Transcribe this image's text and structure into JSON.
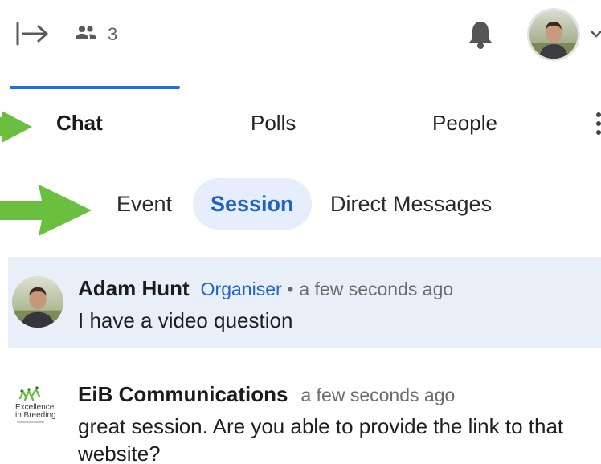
{
  "topbar": {
    "people_count": "3",
    "icons": [
      "exit-arrow-icon",
      "people-icon",
      "bell-icon",
      "user-avatar",
      "chevron-down-icon"
    ]
  },
  "tabs": {
    "items": [
      {
        "label": "Chat",
        "active": true
      },
      {
        "label": "Polls",
        "active": false
      },
      {
        "label": "People",
        "active": false
      }
    ],
    "accent_color": "#1f6fe0"
  },
  "subtabs": {
    "items": [
      {
        "label": "Event",
        "active": false
      },
      {
        "label": "Session",
        "active": true
      },
      {
        "label": "Direct Messages",
        "active": false
      }
    ]
  },
  "annotation_color": "#6abf3f",
  "messages": [
    {
      "name": "Adam Hunt",
      "role": "Organiser",
      "separator": "•",
      "time": "a few seconds ago",
      "text": "I have a video question",
      "highlighted": true
    },
    {
      "name": "EiB Communications",
      "role": "",
      "time": "a few seconds ago",
      "text": "great session. Are you able to provide the link to that website?",
      "logo_text_lines": [
        "Excellence",
        "in Breeding"
      ]
    }
  ]
}
